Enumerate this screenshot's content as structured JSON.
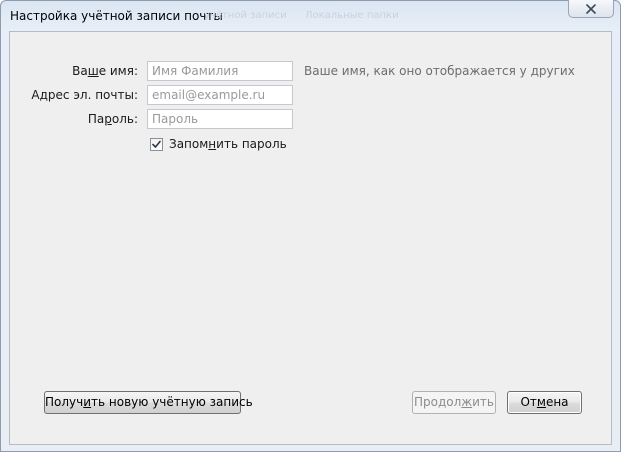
{
  "window": {
    "title": "Настройка учётной записи почты",
    "background_ghost_text_1": "учётной записи",
    "background_ghost_text_2": "Локальные папки",
    "close_icon": "close-icon"
  },
  "form": {
    "name": {
      "label_pre": "Ва",
      "label_accel": "ш",
      "label_post": "е имя:",
      "placeholder": "Имя Фамилия",
      "value": "",
      "hint": "Ваше имя, как оно отображается у других"
    },
    "email": {
      "label": "Адрес эл. почты:",
      "placeholder": "email@example.ru",
      "value": ""
    },
    "password": {
      "label_pre": "Па",
      "label_accel": "р",
      "label_post": "оль:",
      "placeholder": "Пароль",
      "value": ""
    },
    "remember": {
      "label_pre": "Запом",
      "label_accel": "н",
      "label_post": "ить пароль",
      "checked": true
    }
  },
  "buttons": {
    "new_account": {
      "label_pre": "Получ",
      "label_accel": "и",
      "label_post": "ть новую учётную запись"
    },
    "continue": {
      "label_pre": "Продол",
      "label_accel": "ж",
      "label_post": "ить",
      "disabled": true
    },
    "cancel": {
      "label_pre": "От",
      "label_accel": "м",
      "label_post": "ена"
    }
  },
  "colors": {
    "titlebar": "#dbe6f3",
    "client_background": "#efefef",
    "hint_text": "#6d6d6d",
    "disabled_text": "#8d8d8d"
  }
}
